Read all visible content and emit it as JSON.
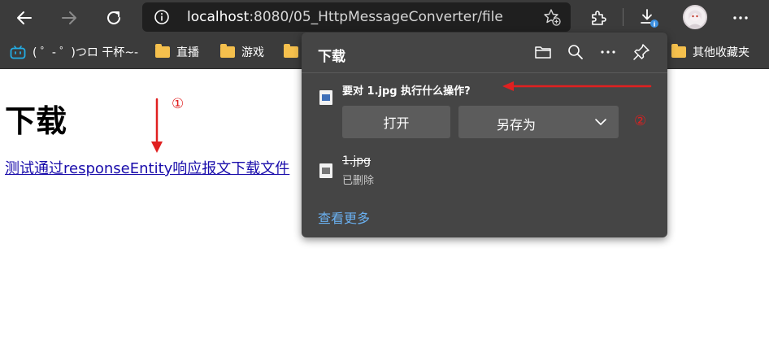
{
  "browser": {
    "url_host": "localhost",
    "url_path": ":8080/05_HttpMessageConverter/file",
    "download_badge": "i"
  },
  "bookmarks": [
    {
      "label": "( ゜- ゜)つロ 干杯~-"
    },
    {
      "label": "直播"
    },
    {
      "label": "游戏"
    },
    {
      "label": "其他收藏夹"
    }
  ],
  "page": {
    "title": "下载",
    "link_text": "测试通过responseEntity响应报文下载文件"
  },
  "downloads": {
    "title": "下载",
    "prompt": "要对 1.jpg 执行什么操作?",
    "open_label": "打开",
    "save_as_label": "另存为",
    "file_name": "1.jpg",
    "file_status": "已删除",
    "see_more": "查看更多"
  },
  "annotations": {
    "marker_1": "①",
    "marker_2": "②",
    "color": "#e02020"
  },
  "colors": {
    "toolbar": "#3b3b3b",
    "panel": "#454545",
    "link": "#1a0dab",
    "accent_link": "#6ab0f0"
  }
}
